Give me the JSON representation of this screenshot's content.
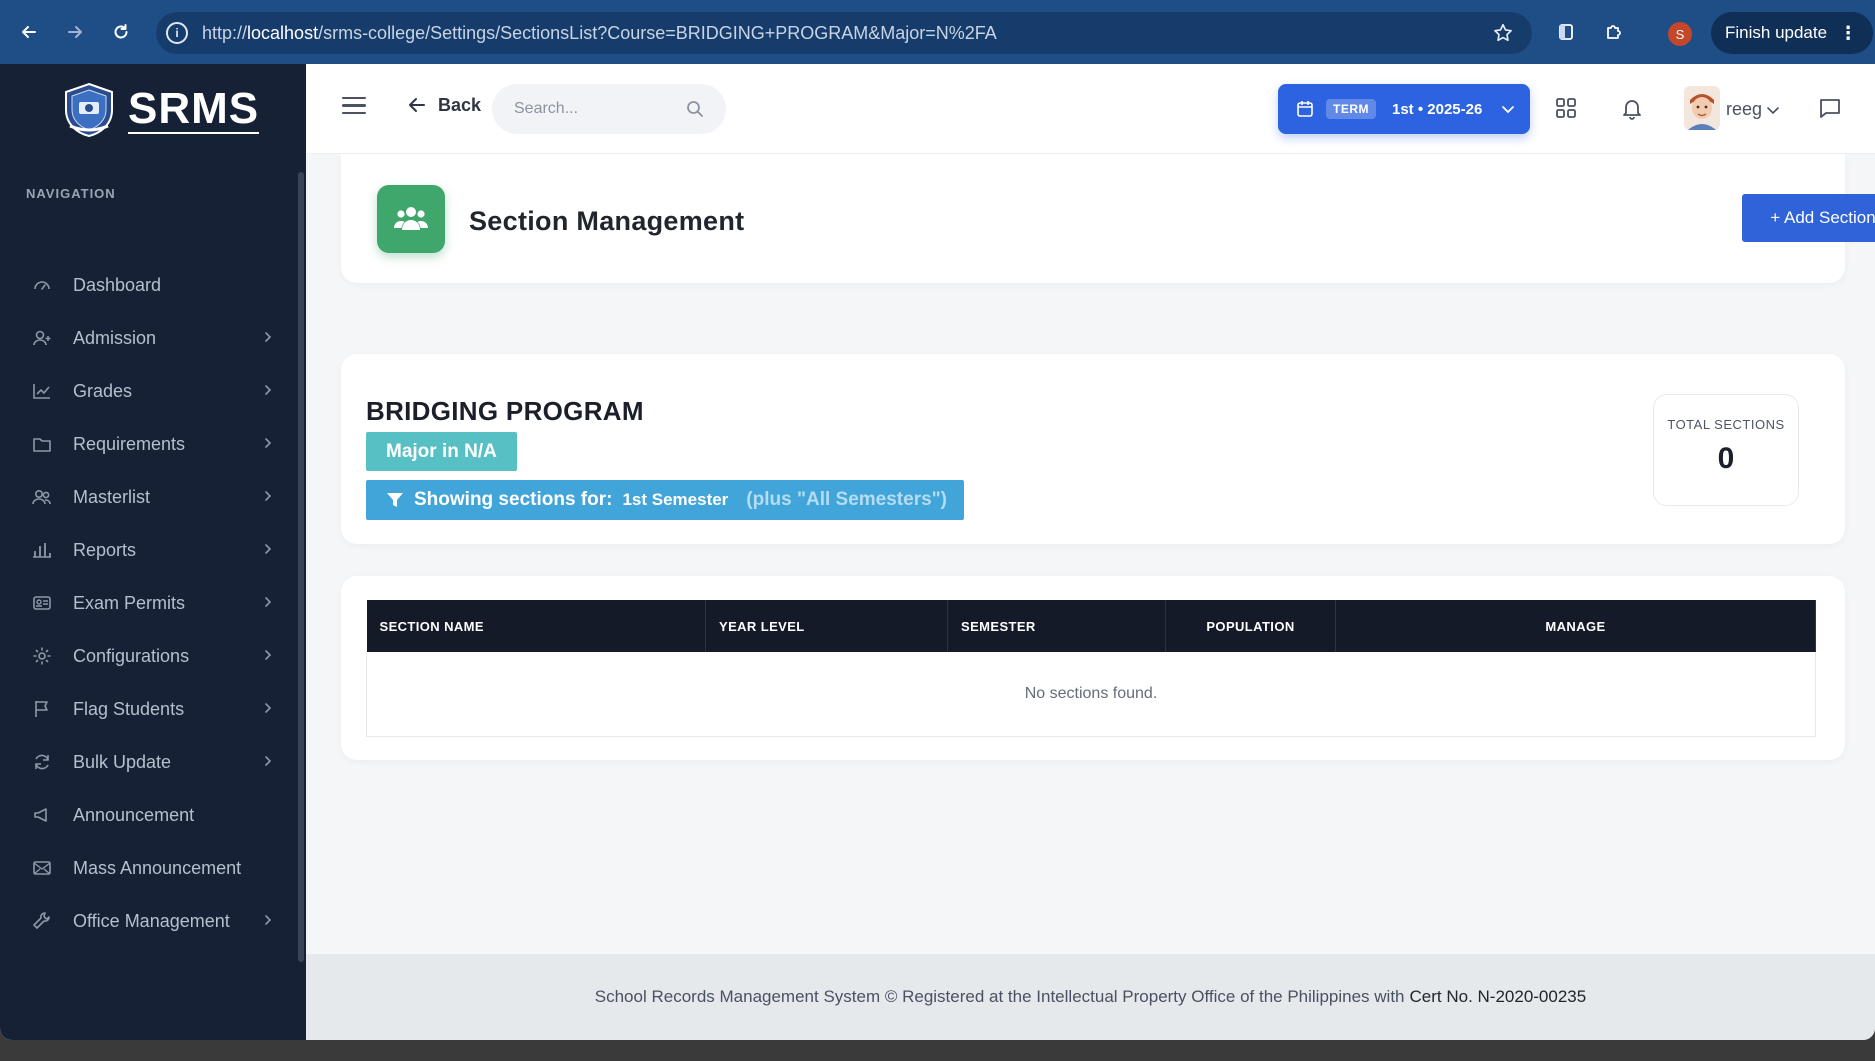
{
  "browser": {
    "url_prefix": "http://",
    "url_host": "localhost",
    "url_path": "/srms-college/Settings/SectionsList?Course=BRIDGING+PROGRAM&Major=N%2FA",
    "profile_initial": "S",
    "finish_update_label": "Finish update"
  },
  "sidebar": {
    "brand": "SRMS",
    "nav_heading": "NAVIGATION",
    "items": [
      {
        "label": "Dashboard",
        "icon": "gauge-icon",
        "has_submenu": false
      },
      {
        "label": "Admission",
        "icon": "user-add-icon",
        "has_submenu": true
      },
      {
        "label": "Grades",
        "icon": "chart-line-icon",
        "has_submenu": true
      },
      {
        "label": "Requirements",
        "icon": "folder-icon",
        "has_submenu": true
      },
      {
        "label": "Masterlist",
        "icon": "users-icon",
        "has_submenu": true
      },
      {
        "label": "Reports",
        "icon": "bar-chart-icon",
        "has_submenu": true
      },
      {
        "label": "Exam Permits",
        "icon": "id-card-icon",
        "has_submenu": true
      },
      {
        "label": "Configurations",
        "icon": "gear-icon",
        "has_submenu": true
      },
      {
        "label": "Flag Students",
        "icon": "flag-icon",
        "has_submenu": true
      },
      {
        "label": "Bulk Update",
        "icon": "refresh-icon",
        "has_submenu": true
      },
      {
        "label": "Announcement",
        "icon": "megaphone-icon",
        "has_submenu": false
      },
      {
        "label": "Mass Announcement",
        "icon": "envelope-icon",
        "has_submenu": false
      },
      {
        "label": "Office Management",
        "icon": "wrench-icon",
        "has_submenu": true
      }
    ]
  },
  "topbar": {
    "back_label": "Back",
    "search_placeholder": "Search...",
    "term_tag": "TERM",
    "term_value": "1st • 2025-26",
    "user_name": "reeg"
  },
  "header": {
    "title": "Section Management",
    "add_button": "+ Add Section"
  },
  "program": {
    "name": "BRIDGING PROGRAM",
    "major": "Major in N/A",
    "filter_prefix": "Showing sections for:",
    "filter_semester": "1st Semester",
    "filter_extra": "(plus \"All Semesters\")",
    "total_label": "TOTAL SECTIONS",
    "total_value": "0"
  },
  "table": {
    "columns": [
      "SECTION NAME",
      "YEAR LEVEL",
      "SEMESTER",
      "POPULATION",
      "MANAGE"
    ],
    "empty_message": "No sections found."
  },
  "footer": {
    "text": "School Records Management System © Registered at the Intellectual Property Office of the Philippines with",
    "cert": "Cert No. N-2020-00235"
  },
  "colors": {
    "sidebar_bg": "#172136",
    "primary": "#2f63d7",
    "header_icon": "#3fa66c",
    "major_badge": "#56c0c5",
    "filter_badge": "#41a5da",
    "table_header": "#141a28"
  }
}
